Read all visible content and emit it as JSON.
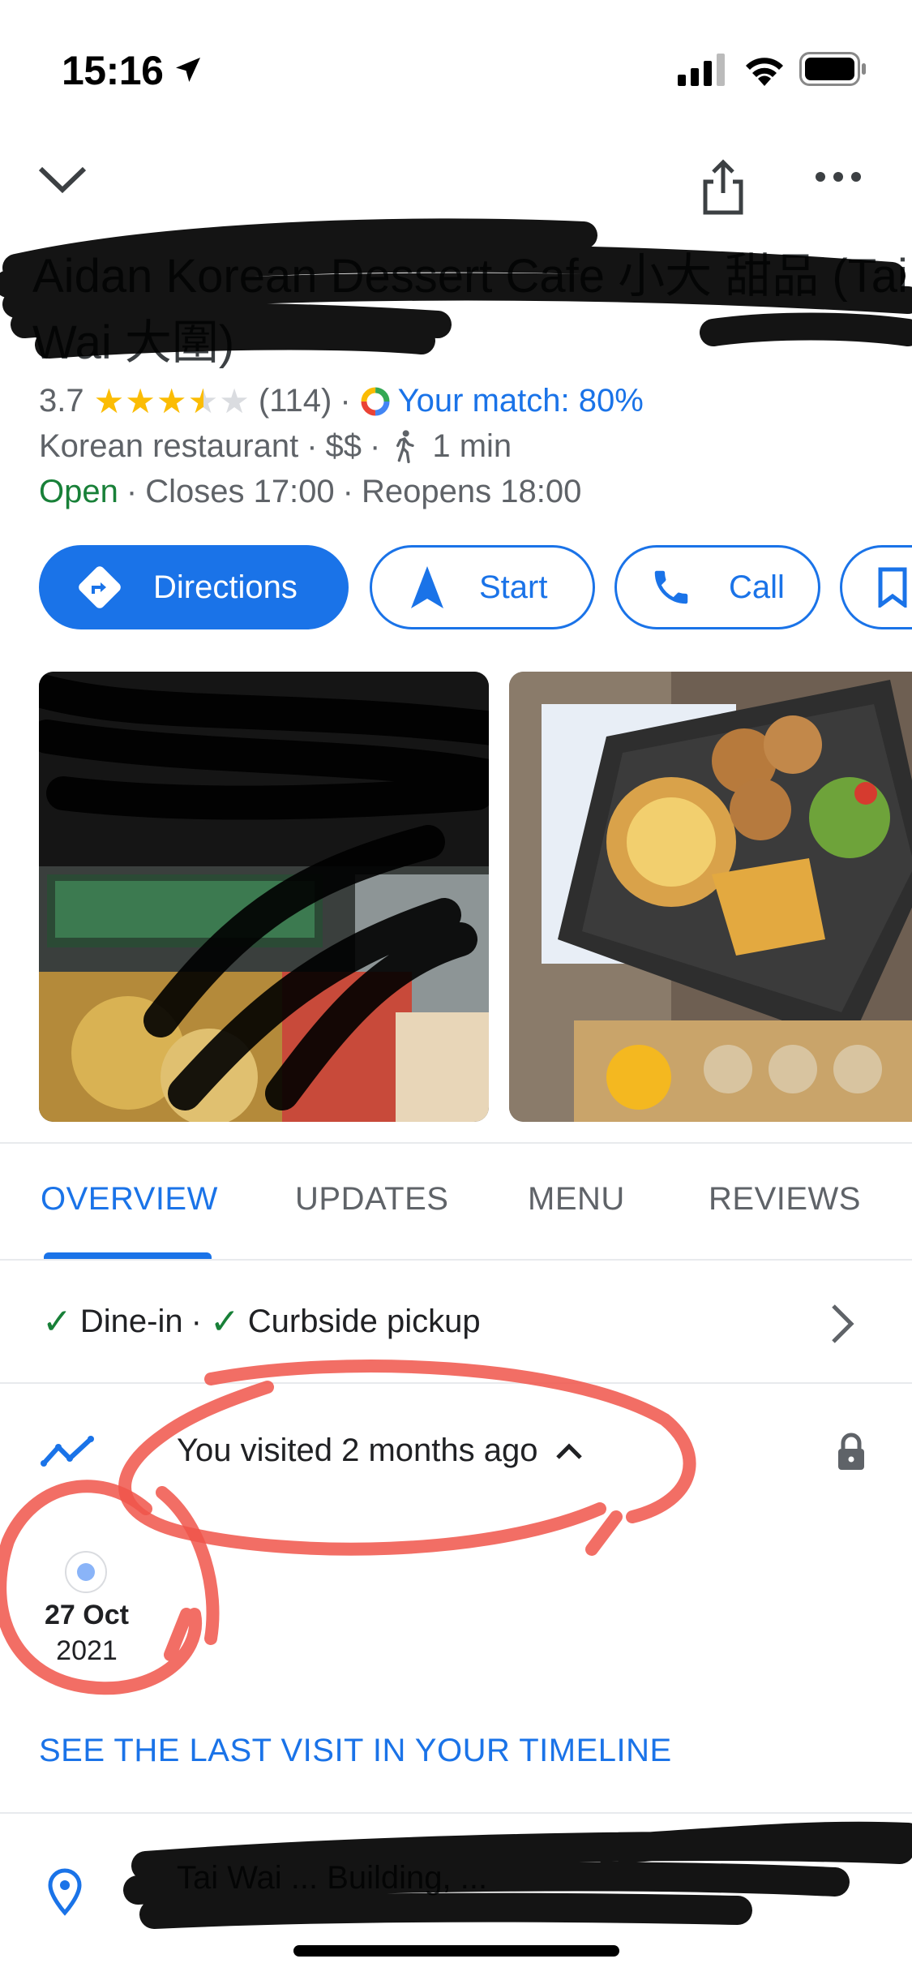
{
  "status_bar": {
    "time": "15:16"
  },
  "place": {
    "title": "Aidan Korean Dessert Cafe 小大 甜品 (Tai Wai 大圍)",
    "rating": "3.7",
    "stars_value": 3.5,
    "reviews_count": "(114)",
    "match": "Your match: 80%",
    "category": "Korean restaurant",
    "price": "$$",
    "walk_time": "1 min",
    "status": "Open",
    "closes": "Closes 17:00",
    "reopens": "Reopens 18:00",
    "address": "Tai Wai ... Building, ..."
  },
  "actions": {
    "directions": "Directions",
    "start": "Start",
    "call": "Call"
  },
  "tabs": [
    "OVERVIEW",
    "UPDATES",
    "MENU",
    "REVIEWS"
  ],
  "amenities": {
    "dine_in": "Dine-in",
    "curbside": "Curbside pickup"
  },
  "visit": {
    "text": "You visited 2 months ago",
    "date": "27 Oct",
    "year": "2021",
    "timeline_link": "SEE THE LAST VISIT IN YOUR TIMELINE"
  },
  "colors": {
    "accent": "#1a73e8",
    "open": "#188038",
    "star": "#fbbc04",
    "annotation": "#f0554a"
  }
}
